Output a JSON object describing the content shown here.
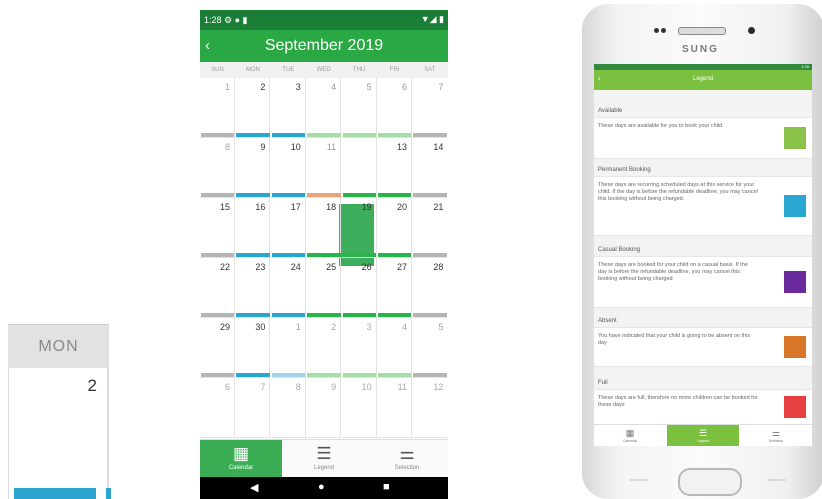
{
  "zoom": {
    "dow": "MON",
    "day": "2"
  },
  "calendar": {
    "status_time": "1:28",
    "status_icons": "⚙ ● ▮",
    "status_right": "▼◢ ▮",
    "back": "‹",
    "title": "September 2019",
    "dows": [
      "SUN",
      "MON",
      "TUE",
      "WED",
      "THU",
      "FRI",
      "SAT"
    ],
    "weeks": [
      [
        {
          "d": "1",
          "t": "dim"
        },
        {
          "d": "2"
        },
        {
          "d": "3"
        },
        {
          "d": "4",
          "t": "light"
        },
        {
          "d": "5",
          "t": "light"
        },
        {
          "d": "6",
          "t": "light"
        },
        {
          "d": "7",
          "t": "light"
        }
      ],
      [
        {
          "d": "8",
          "t": "dim"
        },
        {
          "d": "9"
        },
        {
          "d": "10"
        },
        {
          "d": "11",
          "t": "light"
        },
        {
          "d": "12"
        },
        {
          "d": "13"
        },
        {
          "d": "14"
        }
      ],
      [
        {
          "d": "15"
        },
        {
          "d": "16"
        },
        {
          "d": "17"
        },
        {
          "d": "18"
        },
        {
          "d": "19"
        },
        {
          "d": "20"
        },
        {
          "d": "21"
        }
      ],
      [
        {
          "d": "22"
        },
        {
          "d": "23"
        },
        {
          "d": "24"
        },
        {
          "d": "25"
        },
        {
          "d": "26"
        },
        {
          "d": "27"
        },
        {
          "d": "28"
        }
      ],
      [
        {
          "d": "29"
        },
        {
          "d": "30"
        },
        {
          "d": "1",
          "t": "dim"
        },
        {
          "d": "2",
          "t": "dim"
        },
        {
          "d": "3",
          "t": "dim"
        },
        {
          "d": "4",
          "t": "dim"
        },
        {
          "d": "5",
          "t": "dim"
        }
      ],
      [
        {
          "d": "6",
          "t": "dim"
        },
        {
          "d": "7",
          "t": "dim"
        },
        {
          "d": "8",
          "t": "dim"
        },
        {
          "d": "9",
          "t": "dim"
        },
        {
          "d": "10",
          "t": "dim"
        },
        {
          "d": "11",
          "t": "dim"
        },
        {
          "d": "12",
          "t": "dim"
        }
      ]
    ],
    "selected_day": "12",
    "strip_colors": {
      "grey": "#b5b5b5",
      "blue": "#2aa7d0",
      "lightgreen": "#a6dbaa",
      "green": "#2ab34a",
      "orange": "#e7a37a",
      "lightblue": "#9fd3e8"
    },
    "strips": [
      [
        "grey",
        "blue",
        "blue",
        "lightgreen",
        "lightgreen",
        "lightgreen",
        "grey"
      ],
      [
        "grey",
        "blue",
        "blue",
        "orange",
        "green",
        "green",
        "grey"
      ],
      [
        "grey",
        "blue",
        "blue",
        "green",
        "green",
        "green",
        "grey"
      ],
      [
        "grey",
        "blue",
        "blue",
        "green",
        "green",
        "green",
        "grey"
      ],
      [
        "grey",
        "blue",
        "lightblue",
        "lightgreen",
        "lightgreen",
        "lightgreen",
        "grey"
      ]
    ],
    "nav": [
      {
        "label": "Calendar",
        "icon": "calendar-icon",
        "glyph": "▦",
        "active": true
      },
      {
        "label": "Legend",
        "icon": "list-icon",
        "glyph": "☰",
        "active": false
      },
      {
        "label": "Selection",
        "icon": "sliders-icon",
        "glyph": "⚌",
        "active": false
      }
    ],
    "sys": {
      "back": "◀",
      "home": "●",
      "recent": "■"
    }
  },
  "phone": {
    "brand": "SUNG",
    "status": "1:35",
    "back": "‹",
    "title": "Legend",
    "legend": [
      {
        "title": "Available",
        "desc": "These days are available for you to book your child.",
        "color": "#8bc34a"
      },
      {
        "title": "Permanent Booking",
        "desc": "These days are recurring scheduled days at this service for your child. If the day is before the refundable deadline, you may cancel this booking without being charged.",
        "color": "#2aa7d0"
      },
      {
        "title": "Casual Booking",
        "desc": "These days are booked for your child on a casual basis. If the day is before the refundable deadline, you may cancel this booking without being charged",
        "color": "#6a2a9c"
      },
      {
        "title": "Absent",
        "desc": "You have indicated that your child is going to be absent on this day",
        "color": "#d8772a"
      },
      {
        "title": "Full",
        "desc": "These days are full, therefore no more children can be booked for these days",
        "color": "#e84040"
      }
    ],
    "nav": [
      {
        "label": "Calendar",
        "icon": "calendar-icon",
        "glyph": "▦",
        "active": false
      },
      {
        "label": "Legend",
        "icon": "list-icon",
        "glyph": "☰",
        "active": true
      },
      {
        "label": "Selection",
        "icon": "sliders-icon",
        "glyph": "⚌",
        "active": false
      }
    ]
  }
}
